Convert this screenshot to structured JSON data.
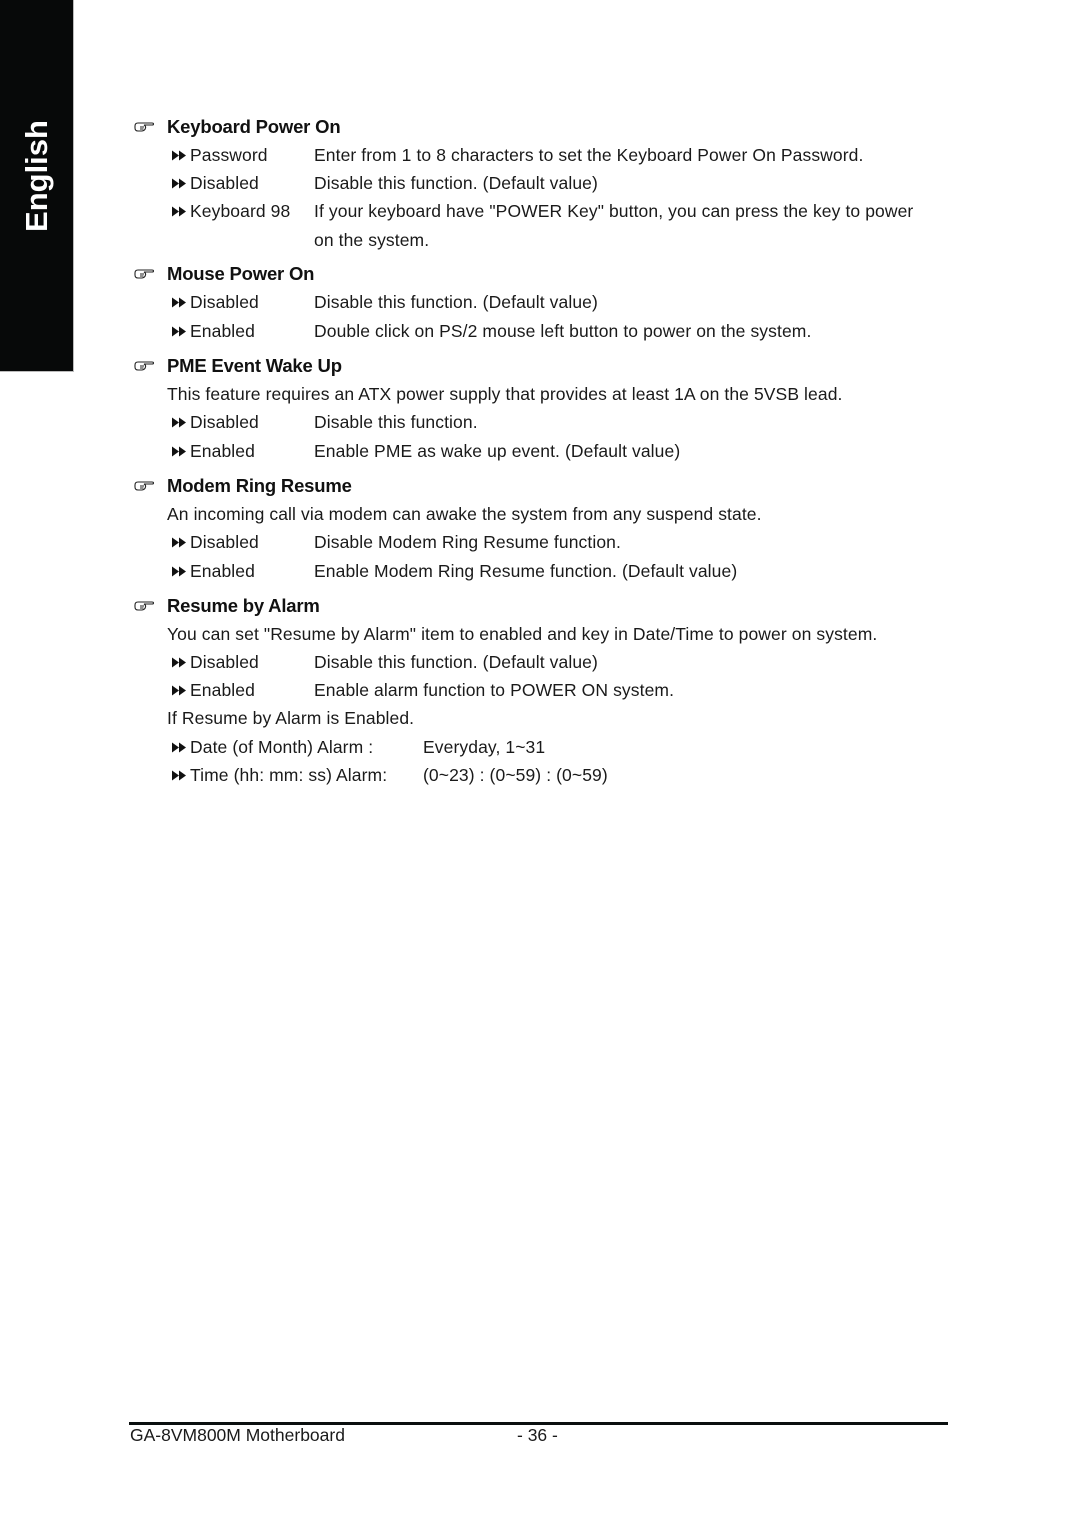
{
  "side_tab": {
    "label": "English"
  },
  "sections": [
    {
      "title": "Keyboard Power On",
      "options": [
        {
          "label": "Password",
          "desc": "Enter from 1 to 8 characters to set the Keyboard Power On Password."
        },
        {
          "label": "Disabled",
          "desc": "Disable this function. (Default value)"
        },
        {
          "label": "Keyboard 98",
          "desc": "If your keyboard have \"POWER Key\" button, you can press the key to power",
          "desc_cont": "on the system."
        }
      ]
    },
    {
      "title": "Mouse Power On",
      "options": [
        {
          "label": "Disabled",
          "desc": "Disable this function. (Default value)"
        },
        {
          "label": "Enabled",
          "desc": "Double click on PS/2 mouse left button to power on the system."
        }
      ]
    },
    {
      "title": "PME Event Wake Up",
      "intro": "This feature requires an ATX power supply that provides at least 1A on the 5VSB lead.",
      "options": [
        {
          "label": "Disabled",
          "desc": "Disable this function."
        },
        {
          "label": "Enabled",
          "desc": "Enable PME as wake up event. (Default value)"
        }
      ]
    },
    {
      "title": "Modem Ring Resume",
      "intro": "An incoming call via modem can awake the system from any suspend state.",
      "options": [
        {
          "label": "Disabled",
          "desc": "Disable Modem Ring Resume function."
        },
        {
          "label": "Enabled",
          "desc": "Enable Modem Ring Resume function. (Default value)"
        }
      ]
    },
    {
      "title": "Resume by Alarm",
      "intro": "You can set \"Resume by Alarm\" item to enabled and key in Date/Time to power on system.",
      "options": [
        {
          "label": "Disabled",
          "desc": "Disable this function. (Default value)"
        },
        {
          "label": "Enabled",
          "desc": "Enable alarm function to POWER ON system."
        }
      ],
      "note": "If Resume by Alarm is Enabled.",
      "alarms": [
        {
          "label": "Date (of Month) Alarm :",
          "value": "Everyday, 1~31"
        },
        {
          "label": "Time (hh: mm: ss) Alarm:",
          "value": "(0~23) : (0~59) : (0~59)"
        }
      ]
    }
  ],
  "footer": {
    "model": "GA-8VM800M Motherboard",
    "page": "- 36 -"
  }
}
